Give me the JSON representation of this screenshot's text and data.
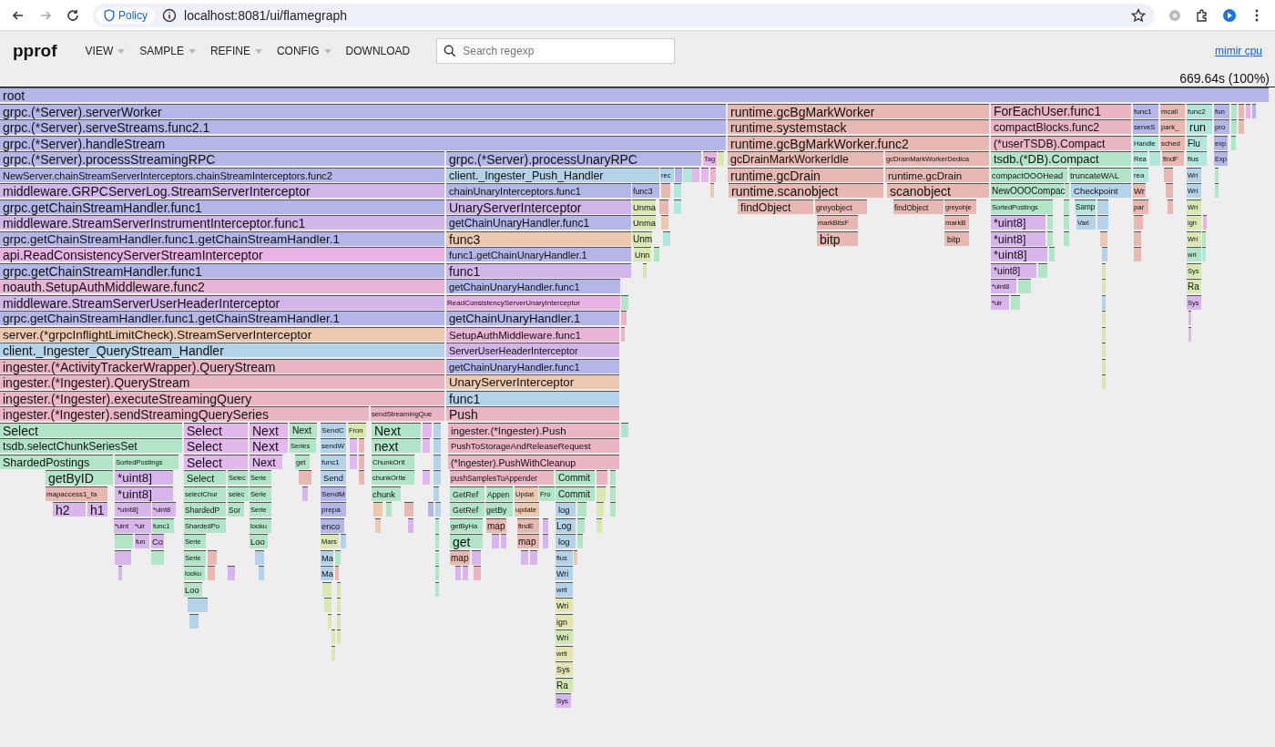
{
  "browser": {
    "policy_label": "Policy",
    "url": "localhost:8081/ui/flamegraph"
  },
  "header": {
    "title": "pprof",
    "menu": [
      {
        "label": "VIEW",
        "dropdown": true
      },
      {
        "label": "SAMPLE",
        "dropdown": true
      },
      {
        "label": "REFINE",
        "dropdown": true
      },
      {
        "label": "CONFIG",
        "dropdown": true
      },
      {
        "label": "DOWNLOAD",
        "dropdown": false
      }
    ],
    "search": {
      "placeholder": "Search regexp"
    },
    "profile_link": "mimir cpu",
    "total": "669.64s (100%)"
  },
  "rows": [
    [
      {
        "name": "root",
        "color": "#b3b6e6"
      }
    ],
    [
      {
        "name": "grpc.(*Server).serverWorker",
        "color": "#b3b6e6"
      },
      {
        "name": "runtime.gcBgMarkWorker",
        "color": "#e8b8b3"
      },
      {
        "name": "ForEachUser.func1",
        "color": "#ebb6c4"
      },
      {
        "name": "func1",
        "color": "#b3b6e6"
      },
      {
        "name": "mcall",
        "color": "#e8b8b3"
      },
      {
        "name": "func2",
        "color": "#b3e6dd"
      },
      {
        "name": "fun",
        "color": "#b3b6e6"
      }
    ],
    [
      {
        "name": "grpc.(*Server).serveStreams.func2.1",
        "color": "#b3b6e6"
      },
      {
        "name": "runtime.systemstack",
        "color": "#e8b8b3"
      },
      {
        "name": "compactBlocks.func2",
        "color": "#ebb6c4"
      },
      {
        "name": "serveS",
        "color": "#b3b6e6"
      },
      {
        "name": "park_",
        "color": "#e8b8b3"
      },
      {
        "name": "run",
        "color": "#b3e6dd"
      },
      {
        "name": "pro",
        "color": "#b3b6e6"
      }
    ],
    [
      {
        "name": "grpc.(*Server).handleStream",
        "color": "#b3b6e6"
      },
      {
        "name": "runtime.gcBgMarkWorker.func2",
        "color": "#e8b8b3"
      },
      {
        "name": "(*userTSDB).Compact",
        "color": "#ebb6c4"
      },
      {
        "name": "Handle",
        "color": "#b3e6dd"
      },
      {
        "name": "sched",
        "color": "#e8b8b3"
      },
      {
        "name": "Flu",
        "color": "#b3e6dd"
      },
      {
        "name": "exp",
        "color": "#b3b6e6"
      }
    ],
    [
      {
        "name": "grpc.(*Server).processStreamingRPC",
        "color": "#b3b6e6"
      },
      {
        "name": "grpc.(*Server).processUnaryRPC",
        "color": "#b3b6e6"
      },
      {
        "name": "Tag",
        "color": "#e8b4e4"
      },
      {
        "name": "gcDrainMarkWorkerIdle",
        "color": "#e8b8b3"
      },
      {
        "name": "gcDrainMarkWorkerDedica",
        "color": "#e8b8b3"
      },
      {
        "name": "tsdb.(*DB).Compact",
        "color": "#b2e5c8"
      },
      {
        "name": "Rea",
        "color": "#b3e6dd"
      },
      {
        "name": "findF",
        "color": "#e8b8b3"
      },
      {
        "name": "flus",
        "color": "#b3e6dd"
      },
      {
        "name": "Exp",
        "color": "#b3b6e6"
      }
    ],
    [
      {
        "name": "NewServer.chainStreamServerInterceptors.chainStreamInterceptors.func2",
        "color": "#b3b6e6"
      },
      {
        "name": "client._Ingester_Push_Handler",
        "color": "#b4d2e8"
      },
      {
        "name": "rec",
        "color": "#b4d2e8"
      },
      {
        "name": "runtime.gcDrain",
        "color": "#e8b8b3"
      },
      {
        "name": "runtime.gcDrain",
        "color": "#e8b8b3"
      },
      {
        "name": "compactOOOHead",
        "color": "#b2e5c8"
      },
      {
        "name": "truncateWAL",
        "color": "#b2e5c8"
      },
      {
        "name": "rea",
        "color": "#b3e6dd"
      },
      {
        "name": "Wri",
        "color": "#b4d2e8"
      }
    ],
    [
      {
        "name": "middleware.GRPCServerLog.StreamServerInterceptor",
        "color": "#d2b6ea"
      },
      {
        "name": "chainUnaryInterceptors.func1",
        "color": "#b3b6e6"
      },
      {
        "name": "func3",
        "color": "#b3b6e6"
      },
      {
        "name": "runtime.scanobject",
        "color": "#e8b8b3"
      },
      {
        "name": "scanobject",
        "color": "#e8b8b3"
      },
      {
        "name": "NewOOOCompac",
        "color": "#b2e5c8"
      },
      {
        "name": "Checkpoint",
        "color": "#b4d2e8"
      },
      {
        "name": "Wr",
        "color": "#e8b8b3"
      },
      {
        "name": "Wri",
        "color": "#b4d2e8"
      }
    ],
    [
      {
        "name": "grpc.getChainStreamHandler.func1",
        "color": "#b3b6e6"
      },
      {
        "name": "UnaryServerInterceptor",
        "color": "#d2b6ea"
      },
      {
        "name": "Unma",
        "color": "#d9e8b3"
      },
      {
        "name": "findObject",
        "color": "#e8b8b3"
      },
      {
        "name": "greyobject",
        "color": "#e8b8b3"
      },
      {
        "name": "findObject",
        "color": "#e8b8b3"
      },
      {
        "name": "greyobje",
        "color": "#e8b8b3"
      },
      {
        "name": "SortedPostings",
        "color": "#b2e5c8"
      },
      {
        "name": "Samp",
        "color": "#b3e6dd"
      },
      {
        "name": "par",
        "color": "#e8b8b3"
      },
      {
        "name": "Wri",
        "color": "#d9e8b3"
      }
    ],
    [
      {
        "name": "middleware.StreamServerInstrumentInterceptor.func1",
        "color": "#d2b6ea"
      },
      {
        "name": "getChainUnaryHandler.func1",
        "color": "#b3b6e6"
      },
      {
        "name": "Unma",
        "color": "#d9e8b3"
      },
      {
        "name": "markBitsF",
        "color": "#e8b8b3"
      },
      {
        "name": "markB",
        "color": "#e8b8b3"
      },
      {
        "name": "*uint8]",
        "color": "#d8b5ea"
      },
      {
        "name": "Vari",
        "color": "#b4d2e8"
      },
      {
        "name": "ign",
        "color": "#d9e8b3"
      }
    ],
    [
      {
        "name": "grpc.getChainStreamHandler.func1.getChainStreamHandler.1",
        "color": "#b3b6e6"
      },
      {
        "name": "func3",
        "color": "#ecc8b0"
      },
      {
        "name": "Unm",
        "color": "#d9e8b3"
      },
      {
        "name": "bitp",
        "color": "#e8b8b3"
      },
      {
        "name": "bitp",
        "color": "#e8b8b3"
      },
      {
        "name": "*uint8]",
        "color": "#d8b5ea"
      },
      {
        "name": "Wri",
        "color": "#d9e8b3"
      }
    ],
    [
      {
        "name": "api.ReadConsistencyServerStreamInterceptor",
        "color": "#e8b4e4"
      },
      {
        "name": "func1.getChainUnaryHandler.1",
        "color": "#b3b6e6"
      },
      {
        "name": "Unn",
        "color": "#d9e8b3"
      },
      {
        "name": "*uint8]",
        "color": "#d8b5ea"
      },
      {
        "name": "wri",
        "color": "#b2e5c8"
      }
    ],
    [
      {
        "name": "grpc.getChainStreamHandler.func1",
        "color": "#b3b6e6"
      },
      {
        "name": "func1",
        "color": "#d2b6ea"
      },
      {
        "name": "*uint8]",
        "color": "#d8b5ea"
      },
      {
        "name": "Sys",
        "color": "#d9e8b3"
      }
    ],
    [
      {
        "name": "noauth.SetupAuthMiddleware.func2",
        "color": "#e8b5d6"
      },
      {
        "name": "getChainUnaryHandler.func1",
        "color": "#b3b6e6"
      },
      {
        "name": "*uint8",
        "color": "#d8b5ea"
      },
      {
        "name": "Ra",
        "color": "#d9e8b3"
      }
    ],
    [
      {
        "name": "middleware.StreamServerUserHeaderInterceptor",
        "color": "#d2b6ea"
      },
      {
        "name": "ReadConsistencyServerUnaryInterceptor",
        "color": "#e8b4e4"
      },
      {
        "name": "*uir",
        "color": "#d8b5ea"
      },
      {
        "name": "Sys",
        "color": "#d8b5ea"
      }
    ],
    [
      {
        "name": "grpc.getChainStreamHandler.func1.getChainStreamHandler.1",
        "color": "#b3b6e6"
      },
      {
        "name": "getChainUnaryHandler.1",
        "color": "#b3b6e6"
      }
    ],
    [
      {
        "name": "server.(*grpcInflightLimitCheck).StreamServerInterceptor",
        "color": "#ecc8b0"
      },
      {
        "name": "SetupAuthMiddleware.func1",
        "color": "#e8b5d6"
      }
    ],
    [
      {
        "name": "client._Ingester_QueryStream_Handler",
        "color": "#b4d2e8"
      },
      {
        "name": "ServerUserHeaderInterceptor",
        "color": "#d2b6ea"
      }
    ],
    [
      {
        "name": "ingester.(*ActivityTrackerWrapper).QueryStream",
        "color": "#ebb6c4"
      },
      {
        "name": "getChainUnaryHandler.func1",
        "color": "#b3b6e6"
      }
    ],
    [
      {
        "name": "ingester.(*Ingester).QueryStream",
        "color": "#ebb6c4"
      },
      {
        "name": "UnaryServerInterceptor",
        "color": "#ecc8b0"
      }
    ],
    [
      {
        "name": "ingester.(*Ingester).executeStreamingQuery",
        "color": "#ebb6c4"
      },
      {
        "name": "func1",
        "color": "#b4d2e8"
      }
    ],
    [
      {
        "name": "ingester.(*Ingester).sendStreamingQuerySeries",
        "color": "#ebb6c4"
      },
      {
        "name": "sendStreamingQue",
        "color": "#ebb6c4"
      },
      {
        "name": "Push",
        "color": "#ebb6c4"
      }
    ],
    [
      {
        "name": "Select",
        "color": "#b2e5c8"
      },
      {
        "name": "Select",
        "color": "#e3b8ec"
      },
      {
        "name": "Next",
        "color": "#e3b8ec"
      },
      {
        "name": "Next",
        "color": "#b2e5c8"
      },
      {
        "name": "SendC",
        "color": "#b4d2e8"
      },
      {
        "name": "Fron",
        "color": "#d9e8b3"
      },
      {
        "name": "Next",
        "color": "#b2e5c8"
      },
      {
        "name": "ingester.(*Ingester).Push",
        "color": "#ebb6c4"
      }
    ],
    [
      {
        "name": "tsdb.selectChunkSeriesSet",
        "color": "#b2e5c8"
      },
      {
        "name": "Select",
        "color": "#e3b8ec"
      },
      {
        "name": "Next",
        "color": "#e3b8ec"
      },
      {
        "name": "Series",
        "color": "#b2e5c8"
      },
      {
        "name": "sendW",
        "color": "#b4d2e8"
      },
      {
        "name": "next",
        "color": "#b2e5c8"
      },
      {
        "name": "PushToStorageAndReleaseRequest",
        "color": "#ebb6c4"
      }
    ],
    [
      {
        "name": "ShardedPostings",
        "color": "#b2e5c8"
      },
      {
        "name": "SortedPostings",
        "color": "#b2e5c8"
      },
      {
        "name": "Select",
        "color": "#e3b8ec"
      },
      {
        "name": "Next",
        "color": "#e3b8ec"
      },
      {
        "name": "get",
        "color": "#b2e5c8"
      },
      {
        "name": "func1",
        "color": "#b4d2e8"
      },
      {
        "name": "ChunkOrIt",
        "color": "#b2e5c8"
      },
      {
        "name": "(*Ingester).PushWithCleanup",
        "color": "#ebb6c4"
      }
    ],
    [
      {
        "name": "getByID",
        "color": "#b2e5c8"
      },
      {
        "name": "*uint8]",
        "color": "#d8b5ea"
      },
      {
        "name": "Select",
        "color": "#b2e5c8"
      },
      {
        "name": "Selec",
        "color": "#b2e5c8"
      },
      {
        "name": "Serie",
        "color": "#b2e5c8"
      },
      {
        "name": "Send",
        "color": "#b4d2e8"
      },
      {
        "name": "chunkOrIte",
        "color": "#b2e5c8"
      },
      {
        "name": "pushSamplesToAppender",
        "color": "#ebb6c4"
      },
      {
        "name": "Commit",
        "color": "#b2e5c8"
      }
    ],
    [
      {
        "name": "mapaccess1_fa",
        "color": "#e8b8b3"
      },
      {
        "name": "*uint8]",
        "color": "#d8b5ea"
      },
      {
        "name": "selectChur",
        "color": "#b2e5c8"
      },
      {
        "name": "selec",
        "color": "#b2e5c8"
      },
      {
        "name": "Serie",
        "color": "#b2e5c8"
      },
      {
        "name": "SendM",
        "color": "#b3b6e6"
      },
      {
        "name": "chunk",
        "color": "#b2e5c8"
      },
      {
        "name": "GetRef",
        "color": "#b2e5c8"
      },
      {
        "name": "Appen",
        "color": "#b2e5c8"
      },
      {
        "name": "Updat",
        "color": "#ecc8b0"
      },
      {
        "name": "Fro",
        "color": "#b2e5c8"
      },
      {
        "name": "Commit",
        "color": "#b2e5c8"
      }
    ],
    [
      {
        "name": "h2",
        "color": "#d8b5ea"
      },
      {
        "name": "h1",
        "color": "#d8b5ea"
      },
      {
        "name": "*uint8]",
        "color": "#d8b5ea"
      },
      {
        "name": "*uint8",
        "color": "#d8b5ea"
      },
      {
        "name": "ShardedP",
        "color": "#b2e5c8"
      },
      {
        "name": "Sor",
        "color": "#b2e5c8"
      },
      {
        "name": "Serie",
        "color": "#b2e5c8"
      },
      {
        "name": "prepa",
        "color": "#b3b6e6"
      },
      {
        "name": "GetRef",
        "color": "#b2e5c8"
      },
      {
        "name": "getBy",
        "color": "#b2e5c8"
      },
      {
        "name": "update",
        "color": "#ecc8b0"
      },
      {
        "name": "log",
        "color": "#b4d2e8"
      }
    ],
    [
      {
        "name": "*uint",
        "color": "#d8b5ea"
      },
      {
        "name": "*uir",
        "color": "#d8b5ea"
      },
      {
        "name": "func1",
        "color": "#b2e5c8"
      },
      {
        "name": "ShardedPo",
        "color": "#b2e5c8"
      },
      {
        "name": "looku",
        "color": "#b2e5c8"
      },
      {
        "name": "enco",
        "color": "#b3b6e6"
      },
      {
        "name": "getByHa",
        "color": "#b2e5c8"
      },
      {
        "name": "map",
        "color": "#e8b8b3"
      },
      {
        "name": "findE",
        "color": "#e8b8b3"
      },
      {
        "name": "Log",
        "color": "#b4d2e8"
      }
    ],
    [
      {
        "name": "fun",
        "color": "#d8b5ea"
      },
      {
        "name": "Co",
        "color": "#d8b5ea"
      },
      {
        "name": "Serie",
        "color": "#b2e5c8"
      },
      {
        "name": "Loo",
        "color": "#b2e5c8"
      },
      {
        "name": "Mars",
        "color": "#d9e8b3"
      },
      {
        "name": "get",
        "color": "#b2e5c8"
      },
      {
        "name": "map",
        "color": "#e8b8b3"
      },
      {
        "name": "log",
        "color": "#b4d2e8"
      }
    ],
    [
      {
        "name": "Serie",
        "color": "#b2e5c8"
      },
      {
        "name": "Ma",
        "color": "#b4d2e8"
      },
      {
        "name": "map",
        "color": "#e8b8b3"
      },
      {
        "name": "flus",
        "color": "#b4d2e8"
      }
    ],
    [
      {
        "name": "looku",
        "color": "#b2e5c8"
      },
      {
        "name": "Ma",
        "color": "#b4d2e8"
      },
      {
        "name": "Wri",
        "color": "#b4d2e8"
      }
    ],
    [
      {
        "name": "Loo",
        "color": "#b2e5c8"
      },
      {
        "name": "writ",
        "color": "#b4d2e8"
      }
    ],
    [
      {
        "name": "Wri",
        "color": "#e3e6b3"
      }
    ],
    [
      {
        "name": "ign",
        "color": "#e3e6b3"
      }
    ],
    [
      {
        "name": "Wri",
        "color": "#d0e8b3"
      }
    ],
    [
      {
        "name": "writ",
        "color": "#e3e6b3"
      }
    ],
    [
      {
        "name": "Sys",
        "color": "#e3e6b3"
      }
    ],
    [
      {
        "name": "Ra",
        "color": "#d0e8b3"
      }
    ],
    [
      {
        "name": "Sys",
        "color": "#d8b5ea"
      }
    ]
  ]
}
